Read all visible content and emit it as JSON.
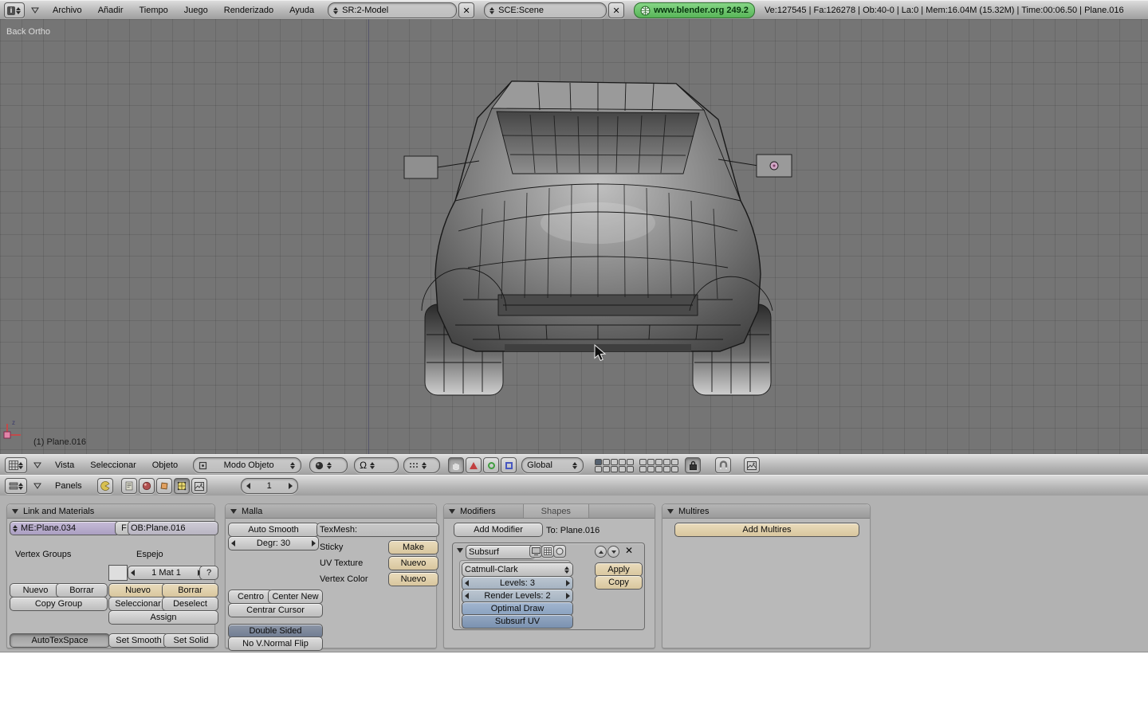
{
  "colors": {
    "link_green": "#6fc76f",
    "toggle_blue": "#8ba3c1",
    "button_tan": "#e0cfae",
    "viewport_gray": "#757575"
  },
  "top_header": {
    "menus": [
      "Archivo",
      "Añadir",
      "Tiempo",
      "Juego",
      "Renderizado",
      "Ayuda"
    ],
    "screen": "SR:2-Model",
    "scene": "SCE:Scene",
    "link": "www.blender.org 249.2",
    "stats": "Ve:127545 | Fa:126278 | Ob:40-0 | La:0 | Mem:16.04M (15.32M)  | Time:00:06.50 | Plane.016"
  },
  "viewport": {
    "view_label": "Back Ortho",
    "object_info": "(1) Plane.016"
  },
  "viewport_header": {
    "menus": [
      "Vista",
      "Seleccionar",
      "Objeto"
    ],
    "mode": "Modo Objeto",
    "orientation": "Global"
  },
  "buttons_header": {
    "panels": "Panels",
    "frame": "1"
  },
  "link_materials": {
    "title": "Link and Materials",
    "me": "ME:Plane.034",
    "f": "F",
    "ob": "OB:Plane.016",
    "vertex_groups": "Vertex Groups",
    "espejo": "Espejo",
    "mat": "1 Mat 1",
    "help": "?",
    "nuevo_l": "Nuevo",
    "borrar_l": "Borrar",
    "copy_group": "Copy Group",
    "nuevo_r": "Nuevo",
    "borrar_r": "Borrar",
    "seleccionar": "Seleccionar",
    "deselect": "Deselect",
    "assign": "Assign",
    "autotex": "AutoTexSpace",
    "set_smooth": "Set Smooth",
    "set_solid": "Set Solid"
  },
  "malla": {
    "title": "Malla",
    "auto_smooth": "Auto Smooth",
    "degr": "Degr: 30",
    "texmesh": "TexMesh:",
    "sticky": "Sticky",
    "make": "Make",
    "uv_texture": "UV Texture",
    "nuevo_uv": "Nuevo",
    "vertex_color": "Vertex Color",
    "nuevo_vc": "Nuevo",
    "centro": "Centro",
    "center_new": "Center New",
    "centrar_cursor": "Centrar Cursor",
    "double_sided": "Double Sided",
    "no_vnormal": "No V.Normal Flip"
  },
  "modifiers": {
    "title": "Modifiers",
    "tab_shapes": "Shapes",
    "add_modifier": "Add Modifier",
    "to": "To: Plane.016",
    "name": "Subsurf",
    "type": "Catmull-Clark",
    "levels": "Levels: 3",
    "render_levels": "Render Levels: 2",
    "optimal_draw": "Optimal Draw",
    "subsurf_uv": "Subsurf UV",
    "apply": "Apply",
    "copy": "Copy"
  },
  "multires": {
    "title": "Multires",
    "add": "Add Multires"
  }
}
